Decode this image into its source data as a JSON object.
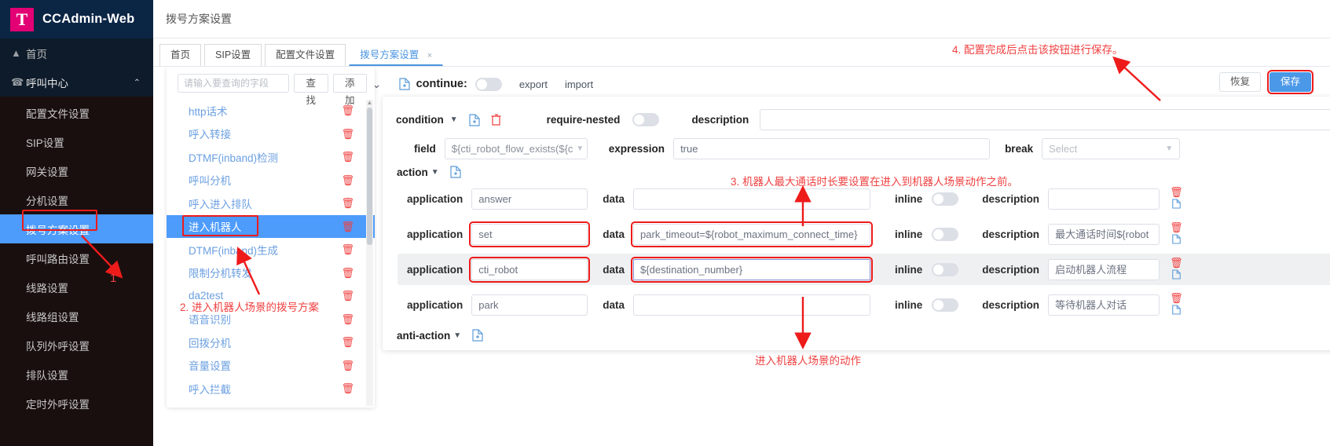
{
  "brand": {
    "logo_letter": "T",
    "name": "CCAdmin-Web"
  },
  "sidebar": {
    "home": {
      "label": "首页",
      "icon": "home-icon"
    },
    "group": {
      "label": "呼叫中心",
      "icon": "phone-icon",
      "chevron": "⌃"
    },
    "items": [
      {
        "label": "配置文件设置"
      },
      {
        "label": "SIP设置"
      },
      {
        "label": "网关设置"
      },
      {
        "label": "分机设置"
      },
      {
        "label": "拨号方案设置",
        "active": true
      },
      {
        "label": "呼叫路由设置"
      },
      {
        "label": "线路设置"
      },
      {
        "label": "线路组设置"
      },
      {
        "label": "队列外呼设置"
      },
      {
        "label": "排队设置"
      },
      {
        "label": "定时外呼设置"
      }
    ]
  },
  "header": {
    "title": "拨号方案设置"
  },
  "tabs": [
    {
      "label": "首页",
      "active": false,
      "closable": false
    },
    {
      "label": "SIP设置",
      "active": false,
      "closable": false
    },
    {
      "label": "配置文件设置",
      "active": false,
      "closable": false
    },
    {
      "label": "拨号方案设置",
      "active": true,
      "closable": true,
      "close": "×"
    }
  ],
  "list_panel": {
    "search_placeholder": "请输入要查询的字段",
    "search_value": "",
    "find_button": "查找",
    "add_button": "添加",
    "items": [
      {
        "label": "http话术"
      },
      {
        "label": "呼入转接"
      },
      {
        "label": "DTMF(inband)检测"
      },
      {
        "label": "呼叫分机"
      },
      {
        "label": "呼入进入排队"
      },
      {
        "label": "进入机器人",
        "selected": true
      },
      {
        "label": "DTMF(inband)生成"
      },
      {
        "label": "限制分机转发"
      },
      {
        "label": "da2test"
      },
      {
        "label": "语音识别"
      },
      {
        "label": "回拨分机"
      },
      {
        "label": "音量设置"
      },
      {
        "label": "呼入拦截"
      }
    ]
  },
  "toolbar": {
    "caret": "⌄",
    "doc_icon": "file-add-icon",
    "continue_label": "continue:",
    "continue_on": false,
    "export_label": "export",
    "import_label": "import",
    "restore_button": "恢复",
    "save_button": "保存"
  },
  "condition": {
    "title": "condition",
    "caret": "▼",
    "copy_icon": "file-add-icon",
    "delete_icon": "trash-icon",
    "require_nested_label": "require-nested",
    "require_nested_on": false,
    "description_label": "description",
    "description_value": "",
    "field_label": "field",
    "field_value": "${cti_robot_flow_exists(${c",
    "expression_label": "expression",
    "expression_value": "true",
    "break_label": "break",
    "break_placeholder": "Select",
    "break_value": ""
  },
  "action": {
    "label": "action",
    "caret": "▼",
    "add_icon": "file-add-icon",
    "col_application": "application",
    "col_data": "data",
    "col_inline": "inline",
    "col_description": "description",
    "rows": [
      {
        "application": "answer",
        "data": "",
        "inline": false,
        "description": "",
        "highlight_application": false,
        "highlight_data": false,
        "alt": false
      },
      {
        "application": "set",
        "data": "park_timeout=${robot_maximum_connect_time}",
        "inline": false,
        "description": "最大通话时间${robot",
        "highlight_application": true,
        "highlight_data": true,
        "alt": false
      },
      {
        "application": "cti_robot",
        "data": "${destination_number}",
        "inline": false,
        "description": "启动机器人流程",
        "highlight_application": true,
        "highlight_data": true,
        "alt": true
      },
      {
        "application": "park",
        "data": "",
        "inline": false,
        "description": "等待机器人对话",
        "highlight_application": false,
        "highlight_data": false,
        "alt": false
      }
    ]
  },
  "anti_action": {
    "label": "anti-action",
    "caret": "▼",
    "add_icon": "file-add-icon"
  },
  "annotations": {
    "a1": "1",
    "a2": "2. 进入机器人场景的拨号方案",
    "a3": "3. 机器人最大通话时长要设置在进入到机器人场景动作之前。",
    "a4": "4. 配置完成后点击该按钮进行保存。",
    "a5": "进入机器人场景的动作"
  },
  "colors": {
    "accent_red": "#f04141",
    "brand_magenta": "#e20074",
    "select_blue": "#4d9bfb",
    "primary_blue": "#4b98e8"
  }
}
